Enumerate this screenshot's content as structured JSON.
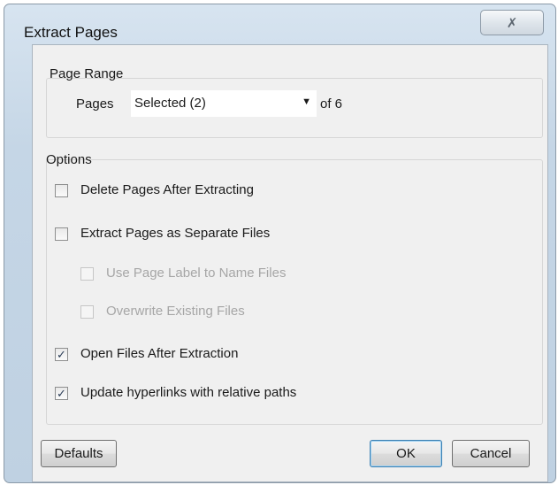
{
  "window": {
    "title": "Extract Pages",
    "close_glyph": "✗"
  },
  "page_range": {
    "label": "Page Range",
    "pages_label": "Pages",
    "selected_value": "Selected (2)",
    "of_text": "of 6"
  },
  "options": {
    "label": "Options",
    "items": [
      {
        "label": "Delete Pages After Extracting",
        "checked": false,
        "enabled": true
      },
      {
        "label": "Extract Pages as Separate Files",
        "checked": false,
        "enabled": true
      },
      {
        "label": "Use Page Label to Name Files",
        "checked": false,
        "enabled": false
      },
      {
        "label": "Overwrite Existing Files",
        "checked": false,
        "enabled": false
      },
      {
        "label": "Open Files After Extraction",
        "checked": true,
        "enabled": true
      },
      {
        "label": "Update hyperlinks with relative paths",
        "checked": true,
        "enabled": true
      }
    ]
  },
  "buttons": {
    "defaults": "Defaults",
    "ok": "OK",
    "cancel": "Cancel"
  }
}
